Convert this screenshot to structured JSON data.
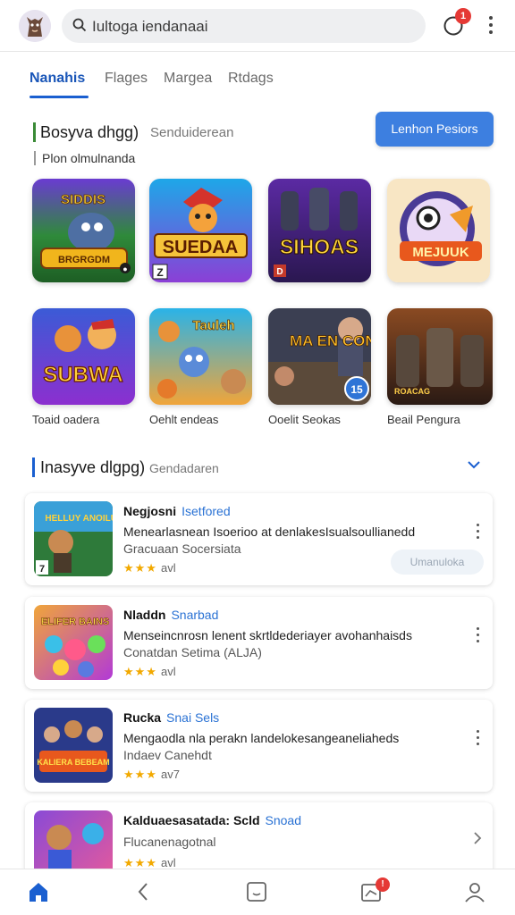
{
  "header": {
    "search_text": "Iultoga iendanaai",
    "notification_count": "1"
  },
  "tabs": [
    {
      "label": "Nanahis"
    },
    {
      "label": "Flages"
    },
    {
      "label": "Margea"
    },
    {
      "label": "Rtdags"
    }
  ],
  "section1": {
    "title": "Bosyva dhgg)",
    "subtitle": "Senduiderean",
    "cta_label": "Lenhon Pesiors",
    "sub_label": "Plon olmulnanda"
  },
  "featured_games": [
    {
      "art": "SIDDIS",
      "art2": "BRGRGDM",
      "badge": "●"
    },
    {
      "art": "SUEDAA",
      "badge": "Z"
    },
    {
      "art": "SIHOAS",
      "badge": "D"
    },
    {
      "art": "MEJUUK"
    }
  ],
  "games_row2": [
    {
      "art": "SUBWA",
      "label": "Toaid oadera"
    },
    {
      "art": "Tauleh",
      "label": "Oehlt endeas"
    },
    {
      "art": "MA EN CONE",
      "badge": "15",
      "label": "Ooelit Seokas"
    },
    {
      "art": "ROACAG",
      "label": "Beail Pengura"
    }
  ],
  "section2": {
    "title": "Inasyve dlgpg)",
    "subtitle": "Gendadaren"
  },
  "list_items": [
    {
      "name": "Negjosni",
      "tag": "Isetfored",
      "desc": "Menearlasnean Isoerioo at denlakesIsualsoullianedd",
      "sub": "Gracuaan Socersiata",
      "stars": "★★★",
      "rating": "avl",
      "art": "HELLUY ANOILUS",
      "badge": "7",
      "pill": "Umanuloka"
    },
    {
      "name": "Nladdn",
      "tag": "Snarbad",
      "desc": "Menseincnrosn lenent skrtldederiayer avohanhaisds",
      "sub": "Conatdan Setima (ALJA)",
      "stars": "★★★",
      "rating": "avl",
      "art": "ELIFER BAINS"
    },
    {
      "name": "Rucka",
      "tag": "Snai Sels",
      "desc": "Mengaodla nla perakn landelokesangeaneliaheds",
      "sub": "Indaev Canehdt",
      "stars": "★★★",
      "rating": "av7",
      "art": "KALIERA BEBEAM"
    },
    {
      "name": "Kalduaesasatada: Scld",
      "tag": "Snoad",
      "desc": "",
      "sub": "Flucanenagotnal",
      "stars": "★★★",
      "rating": "avl",
      "art": ""
    }
  ],
  "bottom_nav": {
    "badge": "!"
  },
  "colors": {
    "accent": "#1a5fd0",
    "cta": "#3d7fe0",
    "section_bar": "#3a8a36",
    "star": "#f2a900",
    "badge": "#e53935"
  },
  "icons": {
    "search": "search-icon",
    "notification": "bell-icon",
    "more": "kebab-menu-icon",
    "nav": [
      "home-icon",
      "back-icon",
      "tablet-icon",
      "inbox-icon",
      "profile-icon"
    ]
  }
}
